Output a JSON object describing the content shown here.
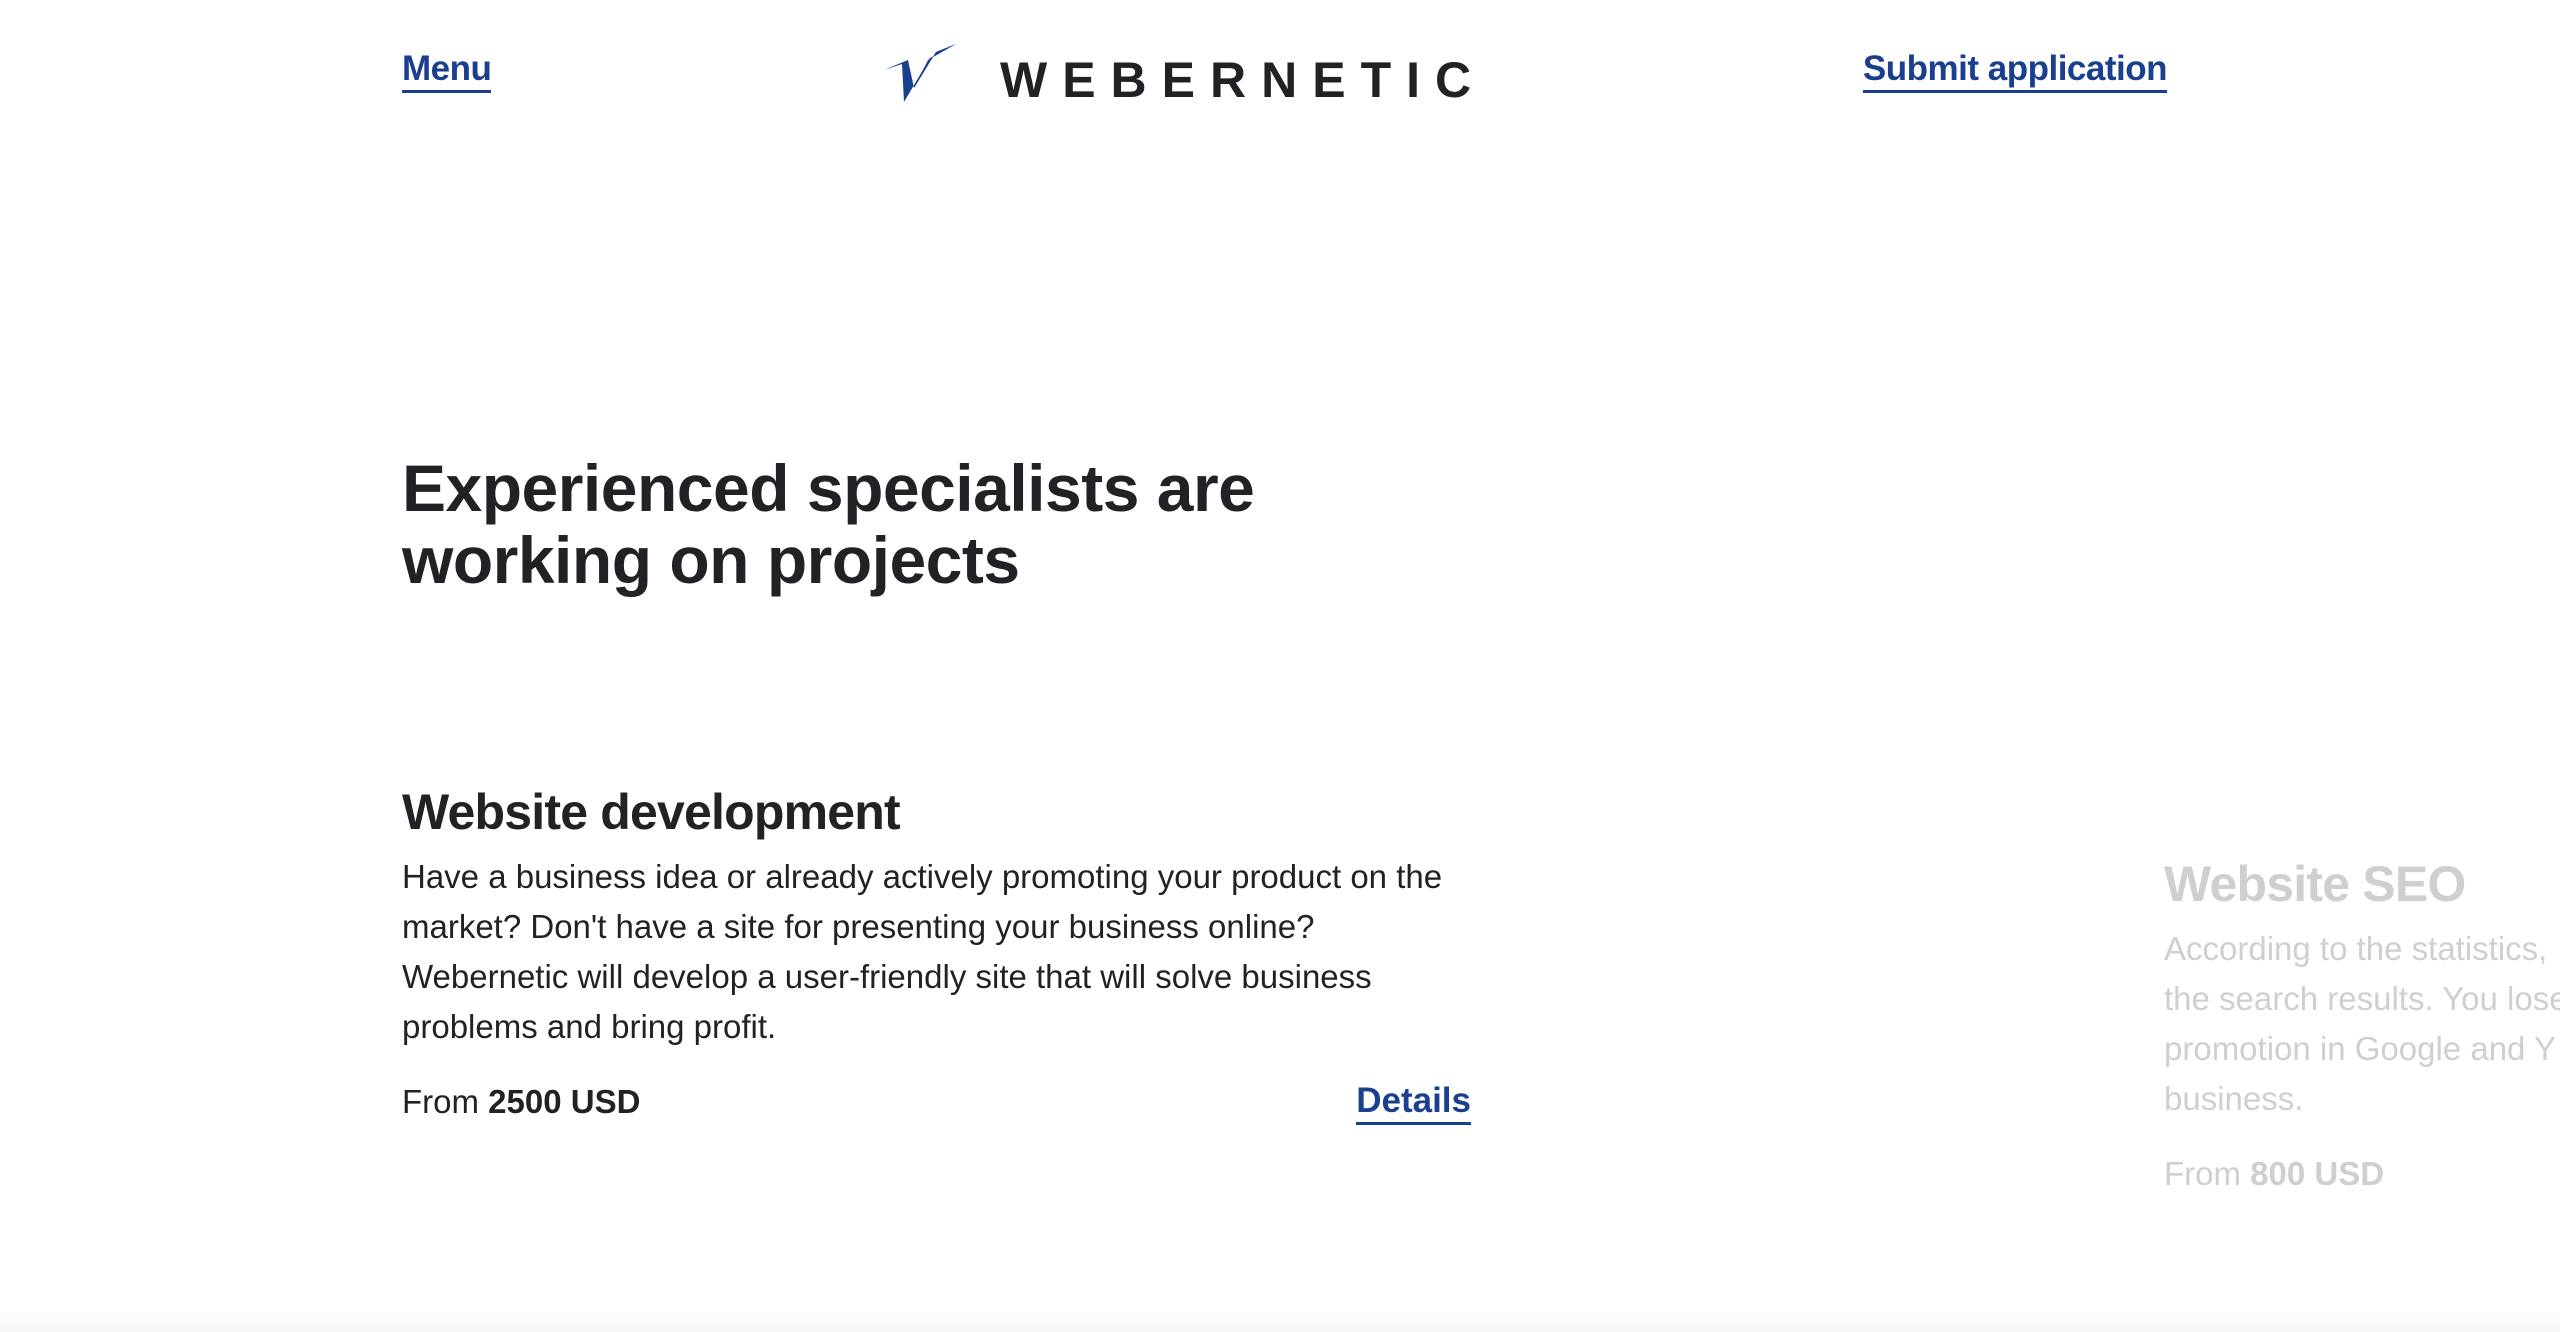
{
  "header": {
    "menu_label": "Menu",
    "logo_text": "WEBERNETIC",
    "logo_icon": "bird-logo-icon",
    "submit_label": "Submit application"
  },
  "hero": {
    "title": "Experienced specialists are working on projects"
  },
  "services": [
    {
      "title": "Website development",
      "description": "Have a business idea or already actively promoting your product on the market? Don't have a site for presenting your business online? Webernetic will develop a user-friendly site that will solve business problems and bring profit.",
      "price_prefix": "From",
      "price_value": "2500 USD",
      "details_label": "Details"
    },
    {
      "title": "Website SEO",
      "description_lines": [
        "According to the statistics,",
        "the search results. You lose",
        "promotion in Google and Y",
        "business."
      ],
      "price_prefix": "From",
      "price_value": "800 USD"
    }
  ],
  "colors": {
    "accent": "#1a3f8f",
    "text": "#222226",
    "faded": "#cfcfd2",
    "background": "#ffffff"
  }
}
